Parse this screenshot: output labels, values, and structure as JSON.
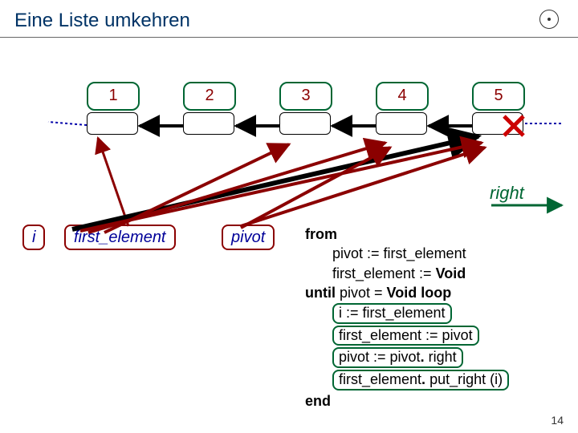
{
  "title": "Eine Liste umkehren",
  "nodes": [
    "1",
    "2",
    "3",
    "4",
    "5"
  ],
  "right_label": "right",
  "vars": {
    "i": "i",
    "first_element": "first_element",
    "pivot": "pivot"
  },
  "code": {
    "from": "from",
    "l1": "pivot := first_element",
    "l2": "first_element := ",
    "void": "Void",
    "until": "until",
    "cond_a": " pivot = ",
    "loop": " loop",
    "h1": "i := first_element",
    "h2": "first_element := pivot",
    "h3": "pivot := pivot",
    "h3_tail": "right",
    "h4a": "first_element",
    "h4b": "put_right (i)",
    "end": "end"
  },
  "pagenum": "14"
}
